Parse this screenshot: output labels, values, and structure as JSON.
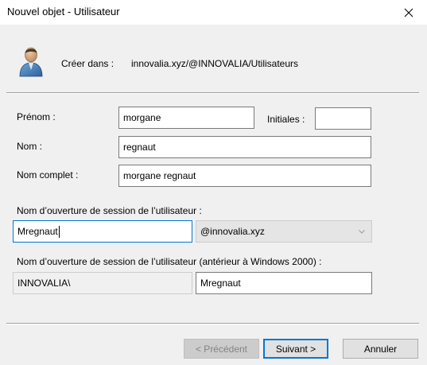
{
  "window": {
    "title": "Nouvel objet - Utilisateur"
  },
  "header": {
    "create_in_label": "Créer dans :",
    "create_in_path": "innovalia.xyz/@INNOVALIA/Utilisateurs"
  },
  "form": {
    "first_name_label": "Prénom :",
    "first_name_value": "morgane",
    "initials_label": "Initiales :",
    "initials_value": "",
    "last_name_label": "Nom :",
    "last_name_value": "regnaut",
    "full_name_label": "Nom complet :",
    "full_name_value": "morgane regnaut",
    "logon_name_label": "Nom d’ouverture de session de l’utilisateur :",
    "logon_name_value": "Mregnaut",
    "domain_suffix_selected": "@innovalia.xyz",
    "legacy_logon_label": "Nom d’ouverture de session de l’utilisateur (antérieur à Windows 2000) :",
    "legacy_domain_value": "INNOVALIA\\",
    "legacy_logon_value": "Mregnaut"
  },
  "buttons": {
    "back": "< Précédent",
    "next": "Suivant >",
    "cancel": "Annuler"
  },
  "icons": {
    "close": "close-icon",
    "user": "user-icon",
    "dropdown": "chevron-down-icon"
  }
}
